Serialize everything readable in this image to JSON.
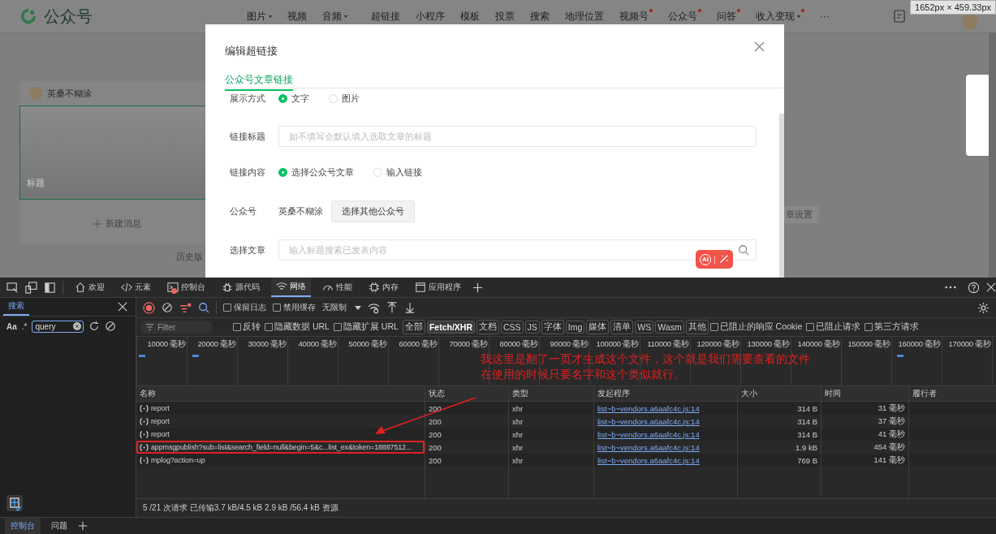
{
  "page": {
    "logo": "公众号",
    "nav": [
      {
        "label": "图片",
        "dropdown": true,
        "dot": false
      },
      {
        "label": "视频",
        "dropdown": false,
        "dot": false
      },
      {
        "label": "音频",
        "dropdown": true,
        "dot": false
      },
      {
        "label": "超链接",
        "dropdown": false,
        "dot": false
      },
      {
        "label": "小程序",
        "dropdown": false,
        "dot": false
      },
      {
        "label": "模板",
        "dropdown": false,
        "dot": false
      },
      {
        "label": "投票",
        "dropdown": false,
        "dot": false
      },
      {
        "label": "搜索",
        "dropdown": false,
        "dot": false
      },
      {
        "label": "地理位置",
        "dropdown": false,
        "dot": false
      },
      {
        "label": "视频号",
        "dropdown": false,
        "dot": true
      },
      {
        "label": "公众号",
        "dropdown": false,
        "dot": true
      },
      {
        "label": "问答",
        "dropdown": false,
        "dot": true
      },
      {
        "label": "收入变现",
        "dropdown": true,
        "dot": true
      }
    ],
    "more": "···",
    "size_tooltip": "1652px × 459.33px",
    "account": "英桑不糊涂",
    "cover_title": "标题",
    "new_message": "新建消息",
    "history": "历史版",
    "settings": "章设置"
  },
  "modal": {
    "title": "编辑超链接",
    "tabs": [
      {
        "label": "公众号文章链接",
        "selected": true
      }
    ],
    "fields": [
      {
        "kind": "radio",
        "label": "展示方式",
        "options": [
          {
            "label": "文字",
            "selected": true
          },
          {
            "label": "图片",
            "selected": false
          }
        ]
      },
      {
        "kind": "input",
        "label": "链接标题",
        "placeholder": "如不填写会默认填入选取文章的标题"
      },
      {
        "kind": "radio",
        "label": "链接内容",
        "options": [
          {
            "label": "选择公众号文章",
            "selected": true
          },
          {
            "label": "输入链接",
            "selected": false
          }
        ]
      },
      {
        "kind": "account",
        "label": "公众号",
        "value": "英桑不糊涂",
        "button": "选择其他公众号"
      },
      {
        "kind": "search",
        "label": "选择文章",
        "placeholder": "输入标题搜索已发表内容"
      }
    ],
    "ai_badge": "AI"
  },
  "devtools": {
    "tabs": [
      {
        "label": "欢迎",
        "selected": false,
        "badge": false
      },
      {
        "label": "元素",
        "selected": false,
        "badge": false
      },
      {
        "label": "控制台",
        "selected": false,
        "badge": true
      },
      {
        "label": "源代码",
        "selected": false,
        "badge": false
      },
      {
        "label": "网络",
        "selected": true,
        "badge": false
      },
      {
        "label": "性能",
        "selected": false,
        "badge": false
      },
      {
        "label": "内存",
        "selected": false,
        "badge": false
      },
      {
        "label": "应用程序",
        "selected": false,
        "badge": false
      }
    ],
    "search_panel": {
      "tab": "搜索",
      "match_case": "Aa",
      "regex": ".*",
      "query": "query"
    },
    "network": {
      "toggles": [
        {
          "label": "保留日志",
          "checked": false
        },
        {
          "label": "禁用缓存",
          "checked": false
        }
      ],
      "throttle": "无限制",
      "filter_placeholder": "Filter",
      "filter_options": [
        {
          "label": "反转",
          "checked": false
        },
        {
          "label": "隐藏数据 URL",
          "checked": false
        },
        {
          "label": "隐藏扩展 URL",
          "checked": false
        }
      ],
      "types": [
        {
          "label": "全部",
          "selected": false
        },
        {
          "label": "Fetch/XHR",
          "selected": true
        },
        {
          "label": "文档",
          "selected": false
        },
        {
          "label": "CSS",
          "selected": false
        },
        {
          "label": "JS",
          "selected": false
        },
        {
          "label": "字体",
          "selected": false
        },
        {
          "label": "Img",
          "selected": false
        },
        {
          "label": "媒体",
          "selected": false
        },
        {
          "label": "清单",
          "selected": false
        },
        {
          "label": "WS",
          "selected": false
        },
        {
          "label": "Wasm",
          "selected": false
        },
        {
          "label": "其他",
          "selected": false
        }
      ],
      "extra_options": [
        {
          "label": "已阻止的响应 Cookie",
          "checked": false
        },
        {
          "label": "已阻止请求",
          "checked": false
        },
        {
          "label": "第三方请求",
          "checked": false
        }
      ],
      "timeline_ticks": [
        "10000 毫秒",
        "20000 毫秒",
        "30000 毫秒",
        "40000 毫秒",
        "50000 毫秒",
        "60000 毫秒",
        "70000 毫秒",
        "80000 毫秒",
        "90000 毫秒",
        "100000 毫秒",
        "110000 毫秒",
        "120000 毫秒",
        "130000 毫秒",
        "140000 毫秒",
        "150000 毫秒",
        "160000 毫秒",
        "170000 毫秒"
      ],
      "columns": [
        "名称",
        "状态",
        "类型",
        "发起程序",
        "大小",
        "时间",
        "履行者"
      ],
      "rows": [
        {
          "name": "report",
          "status": "200",
          "type": "xhr",
          "initiator": "list~b~vendors.a6aafc4c.js:14",
          "size": "314 B",
          "time": "31 毫秒",
          "highlighted": false
        },
        {
          "name": "report",
          "status": "200",
          "type": "xhr",
          "initiator": "list~b~vendors.a6aafc4c.js:14",
          "size": "314 B",
          "time": "37 毫秒",
          "highlighted": false
        },
        {
          "name": "report",
          "status": "200",
          "type": "xhr",
          "initiator": "list~b~vendors.a6aafc4c.js:14",
          "size": "314 B",
          "time": "41 毫秒",
          "highlighted": false
        },
        {
          "name": "appmsgpublish?sub=list&search_field=null&begin=5&c...list_ex&token=18887512...",
          "status": "200",
          "type": "xhr",
          "initiator": "list~b~vendors.a6aafc4c.js:14",
          "size": "1.9 kB",
          "time": "454 毫秒",
          "highlighted": true
        },
        {
          "name": "mplog?action=up",
          "status": "200",
          "type": "xhr",
          "initiator": "list~b~vendors.a6aafc4c.js:14",
          "size": "769 B",
          "time": "141 毫秒",
          "highlighted": false
        }
      ],
      "status_bar": "5 /21 次请求  已传输3.7 kB/4.5 kB  2.9 kB /56.4 kB 资源"
    },
    "drawer_tabs": [
      {
        "label": "控制台",
        "selected": true
      },
      {
        "label": "问题",
        "selected": false
      }
    ]
  },
  "annotation": {
    "lines": [
      "我这里是翻了一页才生成这个文件，这个就是我们需要查看的文件",
      "在使用的时候只要名字和这个类似就行。"
    ]
  }
}
